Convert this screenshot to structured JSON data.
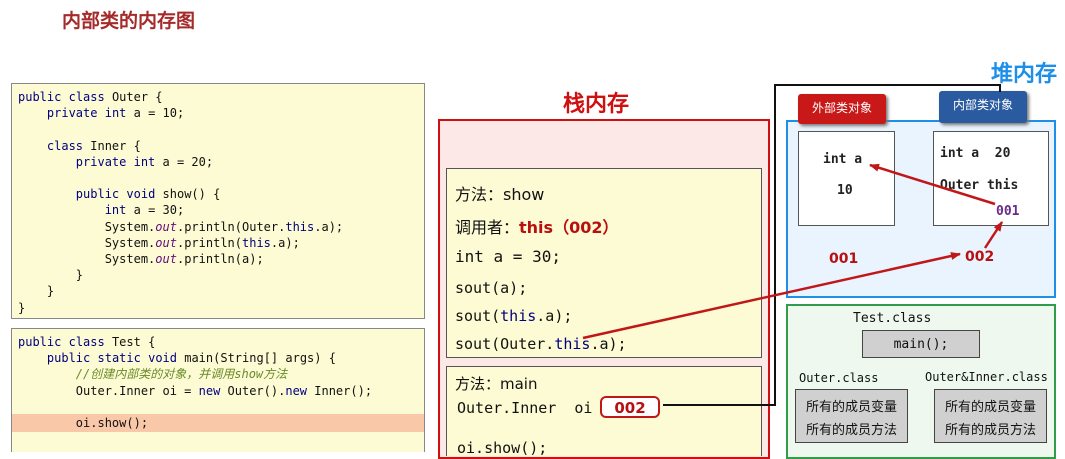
{
  "title": "内部类的内存图",
  "code_outer": [
    "public class Outer {",
    "    private int a = 10;",
    "",
    "    class Inner {",
    "        private int a = 20;",
    "",
    "        public void show() {",
    "            int a = 30;",
    "            System.out.println(Outer.this.a);",
    "            System.out.println(this.a);",
    "            System.out.println(a);",
    "        }",
    "    }",
    "}"
  ],
  "code_test": [
    "public class Test {",
    "    public static void main(String[] args) {",
    "        //创建内部类的对象，并调用show方法",
    "        Outer.Inner oi = new Outer().new Inner();",
    "",
    "        oi.show();"
  ],
  "stack": {
    "label": "栈内存",
    "show_frame": {
      "method": "方法：show",
      "caller_prefix": "调用者：",
      "caller_value": "this（002）",
      "local": "int a = 30;",
      "line1": "sout(a);",
      "line2_pre": "sout(",
      "line2_this": "this",
      "line2_post": ".a);",
      "line3_pre": "sout(Outer.",
      "line3_this": "this",
      "line3_post": ".a);"
    },
    "main_frame": {
      "method": "方法：main",
      "var": "Outer.Inner  oi",
      "ref": "002",
      "call": "oi.show();"
    }
  },
  "heap": {
    "label": "堆内存",
    "outer_badge": "外部类对象",
    "inner_badge": "内部类对象",
    "outer_obj": {
      "field": "int a",
      "value": "10",
      "address": "001"
    },
    "inner_obj": {
      "field": "int a",
      "value": "20",
      "outer_ref_label": "Outer this",
      "outer_ref": "001",
      "address": "002"
    }
  },
  "method_area": {
    "test_class": "Test.class",
    "main": "main();",
    "outer_class": "Outer.class",
    "inner_class": "Outer&Inner.class",
    "members_var": "所有的成员变量",
    "members_method": "所有的成员方法"
  },
  "colors": {
    "stack": "#d01010",
    "heap": "#1e8fe8",
    "method_area": "#2e9e4a",
    "arrow": "#c01818"
  }
}
